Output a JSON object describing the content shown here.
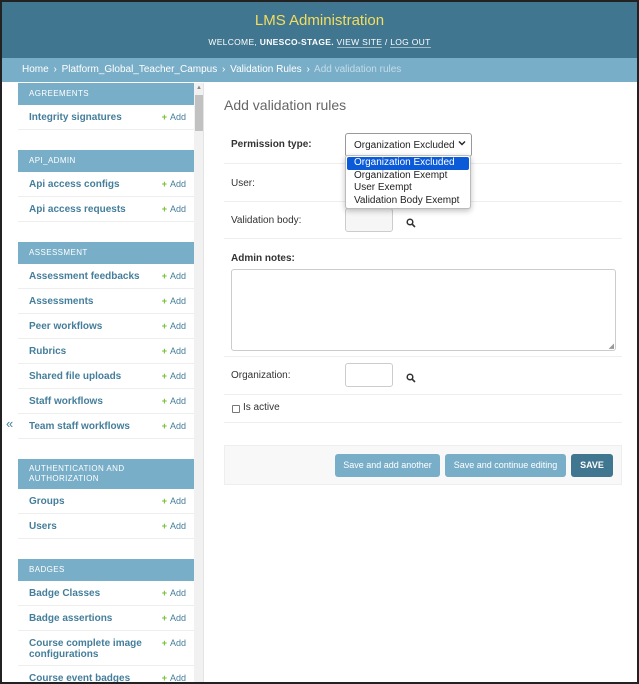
{
  "header": {
    "brand": "LMS Administration",
    "welcome": "WELCOME,",
    "username": "UNESCO-STAGE.",
    "view_site": "VIEW SITE",
    "separator": "/",
    "log_out": "LOG OUT"
  },
  "breadcrumbs": {
    "home": "Home",
    "app": "Platform_Global_Teacher_Campus",
    "model": "Validation Rules",
    "current": "Add validation rules",
    "sep": "›"
  },
  "sidebar": {
    "add_label": "Add",
    "collapse_glyph": "«",
    "modules": [
      {
        "caption": "Agreements",
        "items": [
          "Integrity signatures"
        ]
      },
      {
        "caption": "Api_Admin",
        "items": [
          "Api access configs",
          "Api access requests"
        ]
      },
      {
        "caption": "Assessment",
        "items": [
          "Assessment feedbacks",
          "Assessments",
          "Peer workflows",
          "Rubrics",
          "Shared file uploads",
          "Staff workflows",
          "Team staff workflows"
        ]
      },
      {
        "caption": "Authentication and Authorization",
        "items": [
          "Groups",
          "Users"
        ]
      },
      {
        "caption": "Badges",
        "items": [
          "Badge Classes",
          "Badge assertions",
          "Course complete image configurations",
          "Course event badges"
        ]
      }
    ]
  },
  "form": {
    "title": "Add validation rules",
    "permission_type_label": "Permission type:",
    "permission_type_value": "Organization Excluded",
    "permission_type_options": [
      "Organization Excluded",
      "Organization Exempt",
      "User Exempt",
      "Validation Body Exempt"
    ],
    "user_label": "User:",
    "validation_body_label": "Validation body:",
    "admin_notes_label": "Admin notes:",
    "organization_label": "Organization:",
    "is_active_label": "Is active"
  },
  "actions": {
    "save_add_another": "Save and add another",
    "save_continue": "Save and continue editing",
    "save": "SAVE"
  },
  "colors": {
    "header_bg": "#417690",
    "brand": "#f5dd5d",
    "caption_bg": "#79aec8",
    "link": "#447e9b",
    "add_plus": "#70bf2b",
    "selected_option": "#0b5ad8"
  }
}
